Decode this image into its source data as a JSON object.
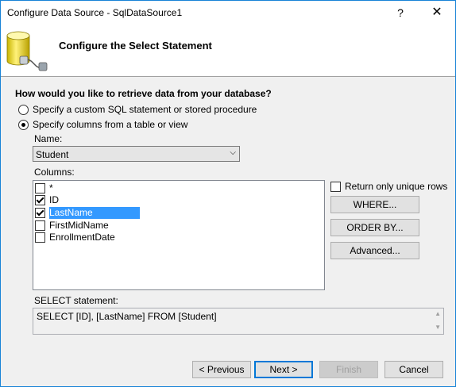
{
  "window": {
    "title": "Configure Data Source - SqlDataSource1",
    "help_glyph": "?",
    "close_glyph": "✕"
  },
  "header": {
    "title": "Configure the Select Statement",
    "icon": "database-plug-icon"
  },
  "main": {
    "question": "How would you like to retrieve data from your database?",
    "options": [
      {
        "label": "Specify a custom SQL statement or stored procedure",
        "checked": false
      },
      {
        "label": "Specify columns from a table or view",
        "checked": true
      }
    ],
    "name_label": "Name:",
    "name_value": "Student",
    "columns_label": "Columns:",
    "columns": [
      {
        "label": "*",
        "checked": false,
        "selected": false
      },
      {
        "label": "ID",
        "checked": true,
        "selected": false
      },
      {
        "label": "LastName",
        "checked": true,
        "selected": true
      },
      {
        "label": "FirstMidName",
        "checked": false,
        "selected": false
      },
      {
        "label": "EnrollmentDate",
        "checked": false,
        "selected": false
      }
    ],
    "unique_rows_label": "Return only unique rows",
    "where_button": "WHERE...",
    "orderby_button": "ORDER BY...",
    "advanced_button": "Advanced...",
    "select_statement_label": "SELECT statement:",
    "select_statement": "SELECT [ID], [LastName] FROM [Student]"
  },
  "footer": {
    "previous": "< Previous",
    "next": "Next >",
    "finish": "Finish",
    "cancel": "Cancel"
  },
  "colors": {
    "accent": "#0078d7",
    "selection": "#3399ff",
    "window_border": "#1883d7"
  }
}
